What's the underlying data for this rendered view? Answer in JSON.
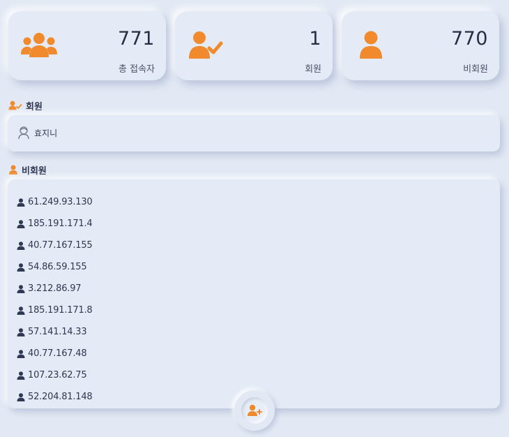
{
  "colors": {
    "accent": "#f08a2c",
    "user_dark": "#2f3a55"
  },
  "stats": [
    {
      "icon": "users-group-icon",
      "value": "771",
      "label": "총 접속자"
    },
    {
      "icon": "user-check-icon",
      "value": "1",
      "label": "회원"
    },
    {
      "icon": "user-icon",
      "value": "770",
      "label": "비회원"
    }
  ],
  "members": {
    "title": "회원",
    "items": [
      {
        "name": "효지니",
        "icon": "user-outline-icon"
      }
    ]
  },
  "guests": {
    "title": "비회원",
    "items": [
      "61.249.93.130",
      "185.191.171.4",
      "40.77.167.155",
      "54.86.59.155",
      "3.212.86.97",
      "185.191.171.8",
      "57.141.14.33",
      "40.77.167.48",
      "107.23.62.75",
      "52.204.81.148"
    ]
  },
  "fab": {
    "icon": "user-plus-icon"
  }
}
